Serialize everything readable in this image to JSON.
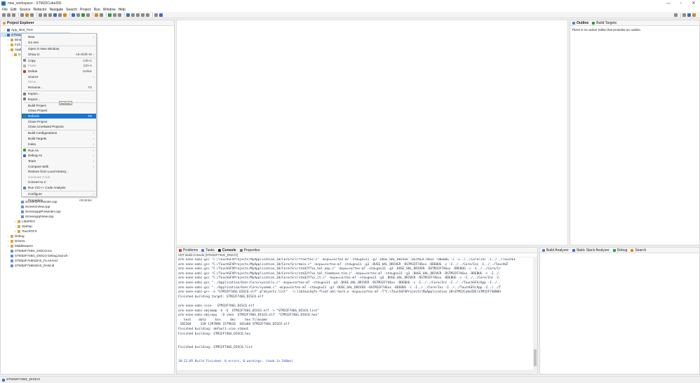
{
  "window": {
    "title": "new_workspace - STM32CubeIDE",
    "controls": [
      "—",
      "▫",
      "✕"
    ]
  },
  "menubar": [
    "File",
    "Edit",
    "Source",
    "Refactor",
    "Navigate",
    "Search",
    "Project",
    "Run",
    "Window",
    "Help"
  ],
  "project_explorer": {
    "tab_label": "Project Explorer",
    "tree_top": [
      {
        "label": "App_limit_TGX",
        "indent": 1,
        "icon": "proj",
        "arrow": "›"
      },
      {
        "label": "STM32F746G_DISCO",
        "indent": 1,
        "icon": "proj",
        "arrow": "⌄",
        "selected": true
      },
      {
        "label": "Bina",
        "indent": 2,
        "icon": "folder",
        "arrow": "›"
      },
      {
        "label": "Inclu",
        "indent": 2,
        "icon": "folder",
        "arrow": "›"
      },
      {
        "label": "Appl",
        "indent": 2,
        "icon": "folder",
        "arrow": "⌄"
      },
      {
        "label": "U",
        "indent": 3,
        "icon": "folder",
        "arrow": "⌄"
      }
    ],
    "tree_bottom": [
      {
        "label": "Screen1Presenter.cpp",
        "indent": 5,
        "icon": "file"
      },
      {
        "label": "Screen1View.cpp",
        "indent": 5,
        "icon": "file"
      },
      {
        "label": "ScreenpppPresenter.cpp",
        "indent": 5,
        "icon": "file"
      },
      {
        "label": "ScreenpppView.cpp",
        "indent": 5,
        "icon": "file"
      },
      {
        "label": "LIBJPEG",
        "indent": 4,
        "icon": "folder",
        "arrow": "›"
      },
      {
        "label": "Startup",
        "indent": 4,
        "icon": "folder",
        "arrow": "›"
      },
      {
        "label": "TouchGFX",
        "indent": 4,
        "icon": "folder",
        "arrow": "›"
      },
      {
        "label": "Debug",
        "indent": 2,
        "icon": "folder",
        "arrow": "›"
      },
      {
        "label": "Drivers",
        "indent": 2,
        "icon": "folder",
        "arrow": "›"
      },
      {
        "label": "Middlewares",
        "indent": 2,
        "icon": "folder",
        "arrow": "›"
      },
      {
        "label": "STM32F746G_DISCO.ioc",
        "indent": 2,
        "icon": "file"
      },
      {
        "label": "STM32F746G_DISCO Debug.launch",
        "indent": 2,
        "icon": "file"
      },
      {
        "label": "STM32F746NGHX_FLASH.ld",
        "indent": 2,
        "icon": "file"
      },
      {
        "label": "STM32F746NGHX_RAM.ld",
        "indent": 2,
        "icon": "file"
      }
    ]
  },
  "context_menu": {
    "items": [
      {
        "label": "New",
        "sub": true
      },
      {
        "label": "Go Into"
      },
      {
        "sep": true
      },
      {
        "label": "Open in New Window"
      },
      {
        "label": "Show In",
        "shortcut": "Alt+Shift+W",
        "sub": true
      },
      {
        "sep": true
      },
      {
        "label": "Copy",
        "shortcut": "Ctrl+C",
        "icon": "#8a8a8a"
      },
      {
        "label": "Paste",
        "shortcut": "Ctrl+V",
        "disabled": true,
        "icon": "#b0b0b0"
      },
      {
        "label": "Delete",
        "shortcut": "Delete",
        "icon": "#c43a3a"
      },
      {
        "label": "Source",
        "sub": true
      },
      {
        "label": "Move...",
        "disabled": true
      },
      {
        "label": "Rename...",
        "shortcut": "F2"
      },
      {
        "sep": true
      },
      {
        "label": "Import...",
        "icon": "#7a7a7a"
      },
      {
        "label": "Export...",
        "icon": "#7a7a7a"
      },
      {
        "sep": true
      },
      {
        "label": "Build Project"
      },
      {
        "label": "Clean Project"
      },
      {
        "label": "Refresh",
        "shortcut": "F5",
        "highlight": true,
        "icon": "#2e9a3e"
      },
      {
        "label": "Close Project"
      },
      {
        "label": "Close Unrelated Projects"
      },
      {
        "sep": true
      },
      {
        "label": "Build Configurations",
        "sub": true
      },
      {
        "label": "Build Targets",
        "sub": true
      },
      {
        "label": "Index",
        "sub": true
      },
      {
        "sep": true
      },
      {
        "label": "Run As",
        "sub": true,
        "icon": "#2e9a3e"
      },
      {
        "label": "Debug As",
        "sub": true,
        "icon": "#3a6fc4"
      },
      {
        "label": "Team",
        "sub": true
      },
      {
        "label": "Compare With",
        "sub": true
      },
      {
        "label": "Restore from Local History..."
      },
      {
        "label": "Generate Code",
        "disabled": true
      },
      {
        "label": "Convert to C"
      },
      {
        "label": "Run C/C++ Code Analysis",
        "icon": "#5a7fc4"
      },
      {
        "sep": true
      },
      {
        "label": "Configure",
        "sub": true
      },
      {
        "sep": true
      },
      {
        "label": "Properties",
        "shortcut": "Alt+Enter"
      }
    ],
    "tooltip": "Refresh"
  },
  "outline": {
    "tabs": [
      "Outline",
      "Build Targets"
    ],
    "message": "There is no active editor that provides an outline."
  },
  "console": {
    "tabs": [
      "Problems",
      "Tasks",
      "Console",
      "Properties"
    ],
    "title": "CDT Build Console [STM32F746G_DISCO]",
    "lines": [
      "arm-none-eabi-gcc \"C:/TouchGFXProjects/MyApplication_10/Core/Src/freertos.c\" -mcpu=cortex-m7 -std=gnu11 -g3 -DUSE_HAL_DRIVER -DSTM32F746xx -DDEBUG -c -I../../Core/Inc -I../../TouchGF",
      "arm-none-eabi-gcc \"C:/TouchGFXProjects/MyApplication_10/Core/Src/main.c\" -mcpu=cortex-m7 -std=gnu11 -g3 -DUSE_HAL_DRIVER -DSTM32F746xx -DDEBUG -c -I../../Core/Inc -I../../TouchGF",
      "arm-none-eabi-gcc \"C:/TouchGFXProjects/MyApplication_10/Core/Src/stm32f7xx_hal_msp.c\" -mcpu=cortex-m7 -std=gnu11 -g3 -DUSE_HAL_DRIVER -DSTM32F746xx -DDEBUG -c -I../../Core/Ir",
      "arm-none-eabi-gcc \"C:/TouchGFXProjects/MyApplication_10/Core/Src/stm32f7xx_hal_timebase_tim.c\" -mcpu=cortex-m7 -std=gnu11 -g3 -DUSE_HAL_DRIVER -DSTM32F746xx -DDEBUG -c -I../.",
      "arm-none-eabi-gcc \"C:/TouchGFXProjects/MyApplication_10/Core/Src/stm32f7xx_it.c\" -mcpu=cortex-m7 -std=gnu11 -g3 -DUSE_HAL_DRIVER -DSTM32F746xx -DDEBUG -c -I../../Core/Inc -I.",
      "arm-none-eabi-gcc \"../Application/User/Core/syscalls.c\" -mcpu=cortex-m7 -std=gnu11 -g3 -DUSE_HAL_DRIVER -DSTM32F746xx -DDEBUG -c -I../../Core/Inc -I../../TouchGFX/App -I../..",
      "arm-none-eabi-gcc \"../Application/User/Core/sysmem.c\" -mcpu=cortex-m7 -std=gnu11 -g3 -DUSE_HAL_DRIVER -DSTM32F746xx -DDEBUG -c -I../../Core/Inc -I../../TouchGFX/App -I../../T",
      "arm-none-eabi-g++ -o \"STM32F746G_DISCO.elf\" @\"objects.list\"  -l:libtouchgfx-float-abi-hard.a -mcpu=cortex-m7 -T\"C:\\TouchGFXProjects\\MyApplication_10\\STM32CubeIDE\\STM32F746NGH",
      "Finished building target: STM32F746G_DISCO.elf",
      "",
      "arm-none-eabi-size   STM32F746G_DISCO.elf",
      "arm-none-eabi-objdump -h -S  STM32F746G_DISCO.elf  > \"STM32F746G_DISCO.list\"",
      "arm-none-eabi-objcopy  -O ihex  STM32F746G_DISCO.elf  \"STM32F746G_DISCO.hex\"",
      "   text    data     bss     dec     hex filename",
      " 182204     328 1397084 1579616  181a60 STM32F746G_DISCO.elf",
      "Finished building: default.size.stdout",
      "Finished building: STM32F746G_DISCO.hex",
      "",
      "",
      "Finished building: STM32F746G_DISCO.list",
      "",
      "",
      "10:22:05 Build Finished. 0 errors, 0 warnings. (took 1s.540ms)"
    ]
  },
  "analyzer": {
    "tabs": [
      "Build Analyzer",
      "Static Stack Analyzer",
      "Debug",
      "Search"
    ]
  },
  "statusbar": {
    "selection": "STM32F746G_DISCO"
  }
}
